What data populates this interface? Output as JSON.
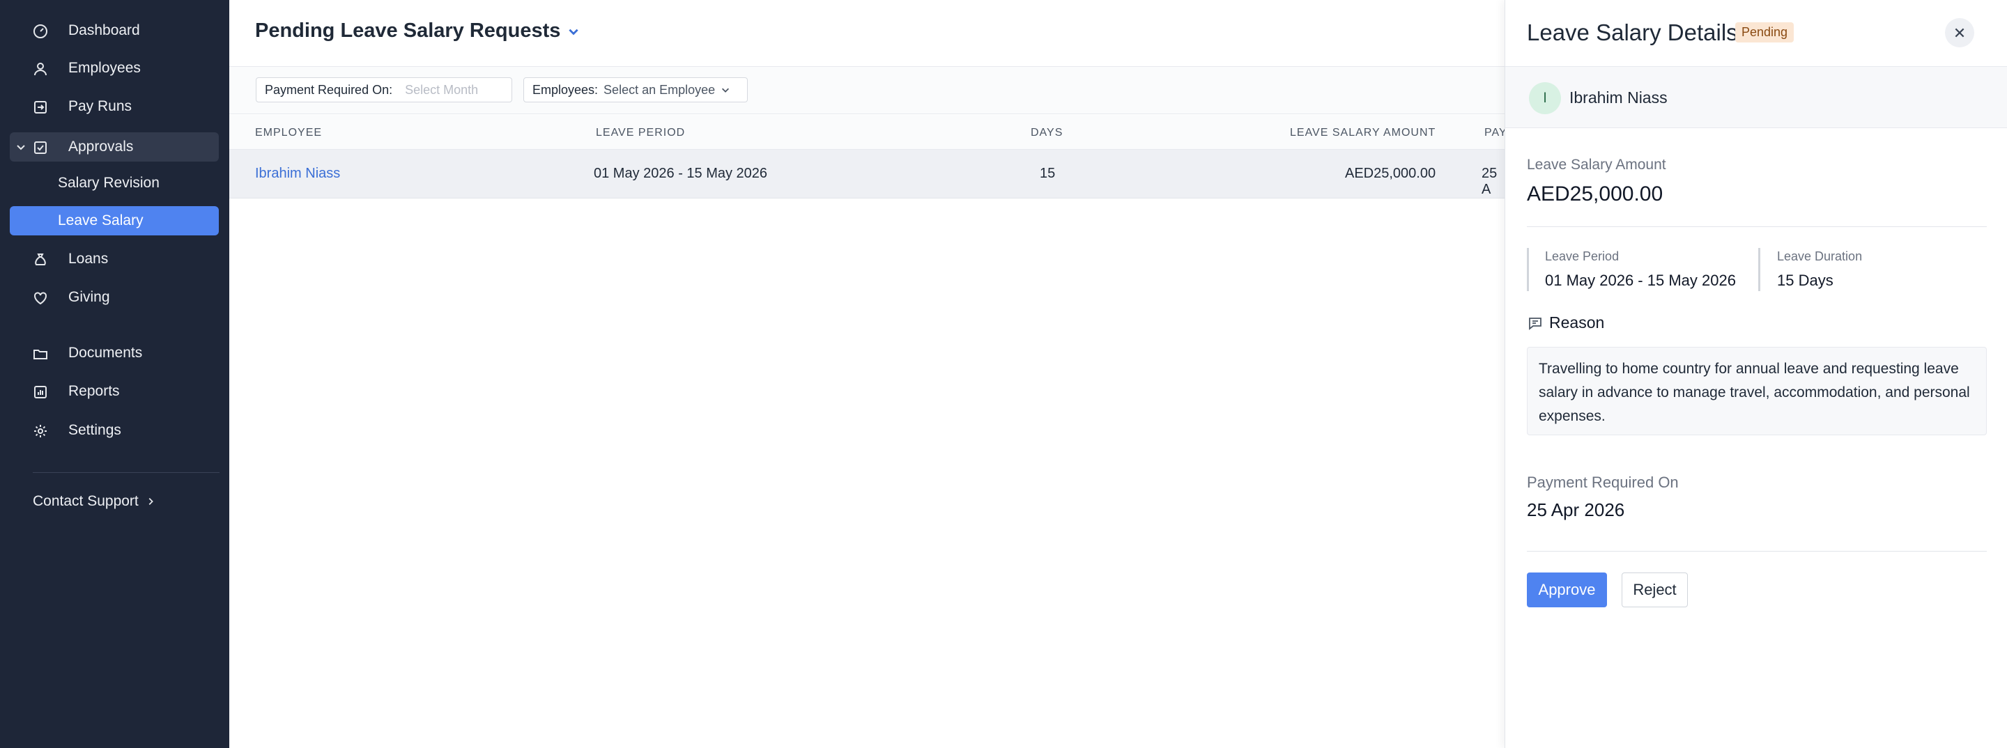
{
  "sidebar": {
    "items": [
      {
        "label": "Dashboard",
        "icon": "dashboard-gauge-icon"
      },
      {
        "label": "Employees",
        "icon": "user-icon"
      },
      {
        "label": "Pay Runs",
        "icon": "pay-runs-icon"
      },
      {
        "label": "Approvals",
        "icon": "approvals-check-icon"
      },
      {
        "label": "Salary Revision"
      },
      {
        "label": "Leave Salary"
      },
      {
        "label": "Loans",
        "icon": "money-bag-icon"
      },
      {
        "label": "Giving",
        "icon": "heart-icon"
      },
      {
        "label": "Documents",
        "icon": "folder-icon"
      },
      {
        "label": "Reports",
        "icon": "bar-chart-icon"
      },
      {
        "label": "Settings",
        "icon": "gear-icon"
      }
    ],
    "support_label": "Contact Support"
  },
  "main": {
    "title": "Pending Leave Salary Requests",
    "filters": {
      "payment_label": "Payment Required On:",
      "payment_placeholder": "Select Month",
      "employees_label": "Employees:",
      "employees_value": "Select an Employee"
    },
    "table": {
      "headers": [
        "EMPLOYEE",
        "LEAVE PERIOD",
        "DAYS",
        "LEAVE SALARY AMOUNT",
        "PAY"
      ],
      "rows": [
        {
          "employee": "Ibrahim Niass",
          "period": "01 May 2026 - 15 May 2026",
          "days": "15",
          "amount": "AED25,000.00",
          "payment": "25 A"
        }
      ]
    }
  },
  "panel": {
    "title": "Leave Salary Details",
    "status": "Pending",
    "employee_initial": "I",
    "employee_name": "Ibrahim Niass",
    "amount_label": "Leave Salary Amount",
    "amount_value": "AED25,000.00",
    "period_label": "Leave Period",
    "period_value": "01 May 2026 - 15 May 2026",
    "duration_label": "Leave Duration",
    "duration_value": "15 Days",
    "reason_label": "Reason",
    "reason_text": "Travelling to home country for annual leave and requesting leave salary in advance to manage travel, accommodation, and personal expenses.",
    "payment_label": "Payment Required On",
    "payment_value": "25 Apr 2026",
    "approve_label": "Approve",
    "reject_label": "Reject"
  },
  "colors": {
    "sidebar_bg": "#1e2638",
    "accent": "#4f83f0",
    "link": "#3b6fd6",
    "pending_badge_bg": "#fbe6d3"
  }
}
